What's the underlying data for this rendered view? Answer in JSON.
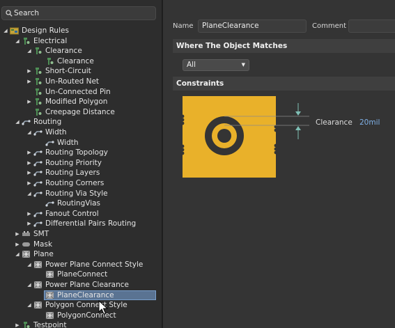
{
  "search": {
    "placeholder": "Search"
  },
  "tree": [
    {
      "label": "Design Rules",
      "depth": 0,
      "arrow": "down",
      "icon": "design-rules-icon",
      "icon_kind": "rules"
    },
    {
      "label": "Electrical",
      "depth": 1,
      "arrow": "down",
      "icon": "electrical-rule-icon",
      "icon_kind": "plug"
    },
    {
      "label": "Clearance",
      "depth": 2,
      "arrow": "down",
      "icon": "clearance-rule-icon",
      "icon_kind": "plug"
    },
    {
      "label": "Clearance",
      "depth": 3,
      "arrow": "",
      "icon": "clearance-rule-icon",
      "icon_kind": "plug"
    },
    {
      "label": "Short-Circuit",
      "depth": 2,
      "arrow": "right",
      "icon": "short-circuit-rule-icon",
      "icon_kind": "plug"
    },
    {
      "label": "Un-Routed Net",
      "depth": 2,
      "arrow": "right",
      "icon": "unrouted-net-rule-icon",
      "icon_kind": "plug"
    },
    {
      "label": "Un-Connected Pin",
      "depth": 2,
      "arrow": "",
      "icon": "unconnected-pin-rule-icon",
      "icon_kind": "plug"
    },
    {
      "label": "Modified Polygon",
      "depth": 2,
      "arrow": "right",
      "icon": "modified-polygon-rule-icon",
      "icon_kind": "plug"
    },
    {
      "label": "Creepage Distance",
      "depth": 2,
      "arrow": "",
      "icon": "creepage-rule-icon",
      "icon_kind": "plug"
    },
    {
      "label": "Routing",
      "depth": 1,
      "arrow": "down",
      "icon": "routing-rule-icon",
      "icon_kind": "route"
    },
    {
      "label": "Width",
      "depth": 2,
      "arrow": "down",
      "icon": "width-rule-icon",
      "icon_kind": "route"
    },
    {
      "label": "Width",
      "depth": 3,
      "arrow": "",
      "icon": "width-rule-icon",
      "icon_kind": "route"
    },
    {
      "label": "Routing Topology",
      "depth": 2,
      "arrow": "right",
      "icon": "routing-topology-icon",
      "icon_kind": "route"
    },
    {
      "label": "Routing Priority",
      "depth": 2,
      "arrow": "right",
      "icon": "routing-priority-icon",
      "icon_kind": "route"
    },
    {
      "label": "Routing Layers",
      "depth": 2,
      "arrow": "right",
      "icon": "routing-layers-icon",
      "icon_kind": "route"
    },
    {
      "label": "Routing Corners",
      "depth": 2,
      "arrow": "right",
      "icon": "routing-corners-icon",
      "icon_kind": "route"
    },
    {
      "label": "Routing Via Style",
      "depth": 2,
      "arrow": "down",
      "icon": "routing-via-style-icon",
      "icon_kind": "route"
    },
    {
      "label": "RoutingVias",
      "depth": 3,
      "arrow": "",
      "icon": "routing-vias-icon",
      "icon_kind": "route"
    },
    {
      "label": "Fanout Control",
      "depth": 2,
      "arrow": "right",
      "icon": "fanout-control-icon",
      "icon_kind": "route"
    },
    {
      "label": "Differential Pairs Routing",
      "depth": 2,
      "arrow": "right",
      "icon": "differential-pairs-icon",
      "icon_kind": "route"
    },
    {
      "label": "SMT",
      "depth": 1,
      "arrow": "right",
      "icon": "smt-rule-icon",
      "icon_kind": "smt"
    },
    {
      "label": "Mask",
      "depth": 1,
      "arrow": "right",
      "icon": "mask-rule-icon",
      "icon_kind": "mask"
    },
    {
      "label": "Plane",
      "depth": 1,
      "arrow": "down",
      "icon": "plane-rule-icon",
      "icon_kind": "plane"
    },
    {
      "label": "Power Plane Connect Style",
      "depth": 2,
      "arrow": "down",
      "icon": "power-plane-connect-icon",
      "icon_kind": "plane"
    },
    {
      "label": "PlaneConnect",
      "depth": 3,
      "arrow": "",
      "icon": "plane-connect-icon",
      "icon_kind": "plane"
    },
    {
      "label": "Power Plane Clearance",
      "depth": 2,
      "arrow": "down",
      "icon": "power-plane-clearance-icon",
      "icon_kind": "plane"
    },
    {
      "label": "PlaneClearance",
      "depth": 3,
      "arrow": "",
      "icon": "plane-clearance-icon",
      "icon_kind": "plane",
      "selected": true
    },
    {
      "label": "Polygon Connect Style",
      "depth": 2,
      "arrow": "down",
      "icon": "polygon-connect-style-icon",
      "icon_kind": "plane"
    },
    {
      "label": "PolygonConnect",
      "depth": 3,
      "arrow": "",
      "icon": "polygon-connect-icon",
      "icon_kind": "plane"
    },
    {
      "label": "Testpoint",
      "depth": 1,
      "arrow": "right",
      "icon": "testpoint-rule-icon",
      "icon_kind": "plug"
    }
  ],
  "rule": {
    "name_label": "Name",
    "name_value": "PlaneClearance",
    "comment_label": "Comment",
    "comment_value": ""
  },
  "where_matches": {
    "title": "Where The Object Matches",
    "selected": "All"
  },
  "constraints": {
    "title": "Constraints",
    "clearance_label": "Clearance",
    "clearance_value": "20mil"
  },
  "colors": {
    "plane": "#e9b12a",
    "value_link": "#7fb0e6",
    "selection": "#5a7392"
  }
}
